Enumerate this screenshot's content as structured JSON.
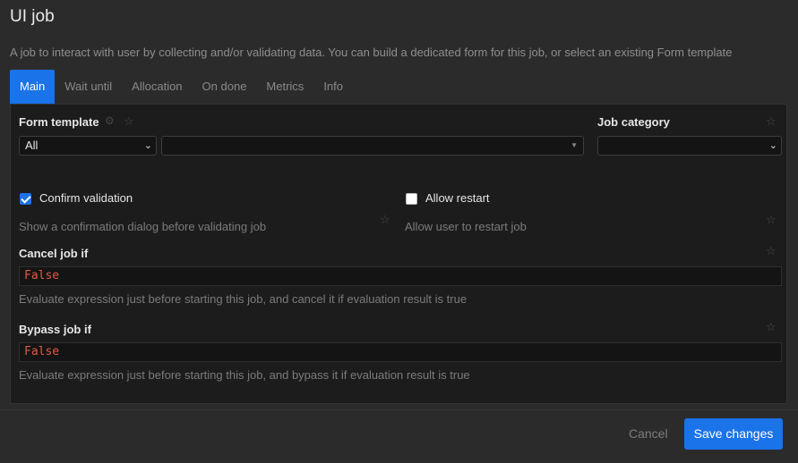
{
  "header": {
    "title": "UI job",
    "subtitle": "A job to interact with user by collecting and/or validating data. You can build a dedicated form for this job, or select an existing Form template"
  },
  "tabs": [
    {
      "label": "Main",
      "active": true
    },
    {
      "label": "Wait until",
      "active": false
    },
    {
      "label": "Allocation",
      "active": false
    },
    {
      "label": "On done",
      "active": false
    },
    {
      "label": "Metrics",
      "active": false
    },
    {
      "label": "Info",
      "active": false
    }
  ],
  "form": {
    "form_template": {
      "label": "Form template",
      "filter_value": "All",
      "template_value": ""
    },
    "job_category": {
      "label": "Job category",
      "value": ""
    },
    "confirm_validation": {
      "label": "Confirm validation",
      "checked": true,
      "help": "Show a confirmation dialog before validating job"
    },
    "allow_restart": {
      "label": "Allow restart",
      "checked": false,
      "help": "Allow user to restart job"
    },
    "cancel_job_if": {
      "label": "Cancel job if",
      "value": "False",
      "help": "Evaluate expression just before starting this job, and cancel it if evaluation result is true"
    },
    "bypass_job_if": {
      "label": "Bypass job if",
      "value": "False",
      "help": "Evaluate expression just before starting this job, and bypass it if evaluation result is true"
    }
  },
  "footer": {
    "cancel_label": "Cancel",
    "save_label": "Save changes"
  },
  "colors": {
    "accent": "#1a73e8",
    "code_text": "#e05a47"
  }
}
